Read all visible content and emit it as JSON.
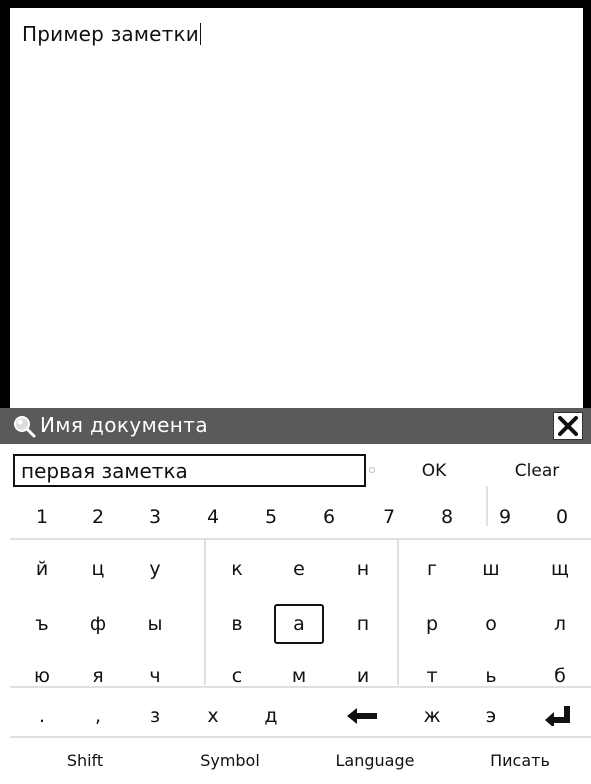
{
  "editor": {
    "text": "Пример заметки"
  },
  "dialog": {
    "title": "Имя документа",
    "input_value": "первая заметка",
    "ok_label": "OK",
    "clear_label": "Clear"
  },
  "keyboard": {
    "row1": [
      "1",
      "2",
      "3",
      "4",
      "5",
      "6",
      "7",
      "8",
      "9",
      "0"
    ],
    "row2": [
      "й",
      "ц",
      "у",
      "к",
      "е",
      "н",
      "г",
      "ш",
      "щ"
    ],
    "row3": [
      "ъ",
      "ф",
      "ы",
      "в",
      "а",
      "п",
      "р",
      "о",
      "л"
    ],
    "row4": [
      "ю",
      "я",
      "ч",
      "с",
      "м",
      "и",
      "т",
      "ь",
      "б"
    ],
    "row5": [
      ".",
      ",",
      "з",
      "х",
      "д",
      "ж",
      "э"
    ],
    "backspace_icon": "backspace-arrow-icon",
    "enter_icon": "enter-return-icon",
    "shift_label": "Shift",
    "symbol_label": "Symbol",
    "language_label": "Language",
    "write_label": "Писать"
  }
}
